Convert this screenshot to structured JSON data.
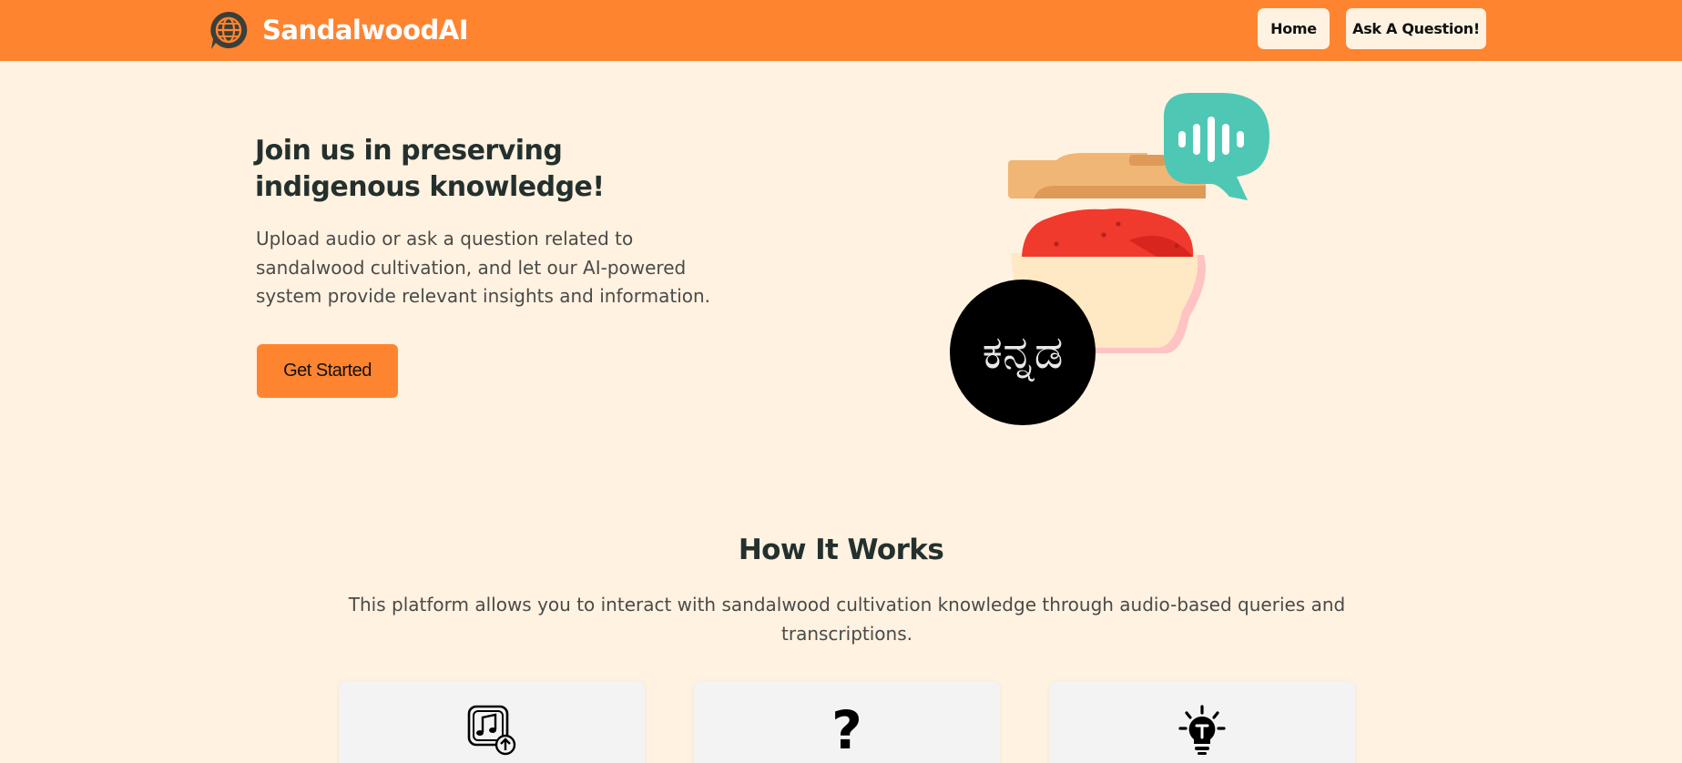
{
  "navbar": {
    "brand": "SandalwoodAI",
    "home_label": "Home",
    "ask_label": "Ask A Question!"
  },
  "hero": {
    "title": "Join us in preserving indigenous knowledge!",
    "description": "Upload audio or ask a question related to sandalwood cultivation, and let our AI-powered system provide relevant insights and information.",
    "cta_label": "Get Started",
    "language_badge": "ಕನ್ನಡ"
  },
  "how_it_works": {
    "title": "How It Works",
    "description": "This platform allows you to interact with sandalwood cultivation knowledge through audio-based queries and transcriptions.",
    "cards": [
      {
        "icon": "audio-upload-icon"
      },
      {
        "icon": "question-mark-icon"
      },
      {
        "icon": "lightbulb-icon"
      }
    ]
  },
  "colors": {
    "accent": "#ff8430",
    "background": "#fff2e0",
    "speech_bubble": "#4fc7b5",
    "spice_red": "#f03a2e"
  }
}
